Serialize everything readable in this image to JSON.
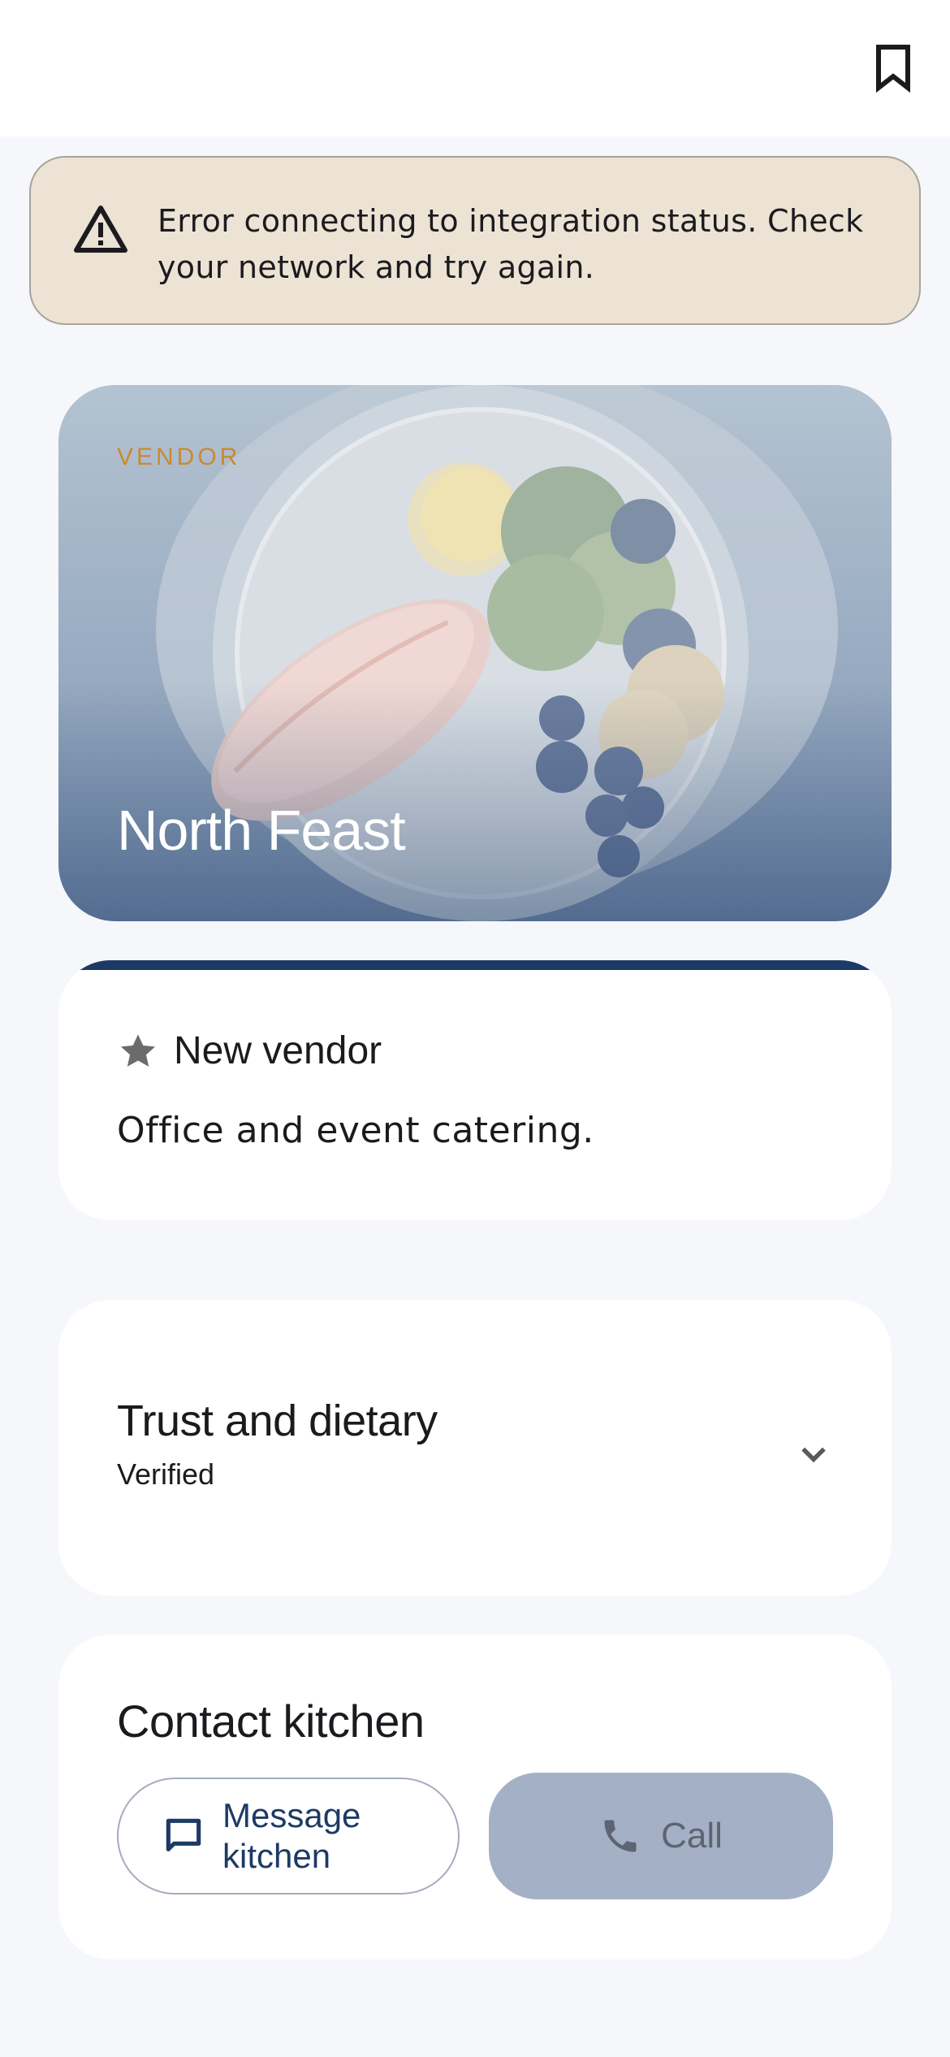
{
  "header": {
    "bookmark_icon": "bookmark-icon"
  },
  "banner": {
    "icon": "warning-icon",
    "message": "Error connecting to integration status. Check your network and try again."
  },
  "hero": {
    "tag": "VENDOR",
    "title": "North Feast"
  },
  "new_vendor": {
    "icon": "star-icon",
    "label": "New vendor",
    "description": "Office and event catering.",
    "accent_color": "#1d3a66"
  },
  "trust": {
    "title": "Trust and dietary",
    "status": "Verified",
    "icon": "chevron-down-icon"
  },
  "contact": {
    "title": "Contact kitchen",
    "message_button": "Message kitchen",
    "message_icon": "message-icon",
    "call_button": "Call",
    "call_icon": "phone-icon"
  },
  "colors": {
    "banner_bg": "#ece3d4",
    "tag": "#c98a2e",
    "primary": "#1d3a66",
    "disabled_button": "#a4b0c5"
  }
}
